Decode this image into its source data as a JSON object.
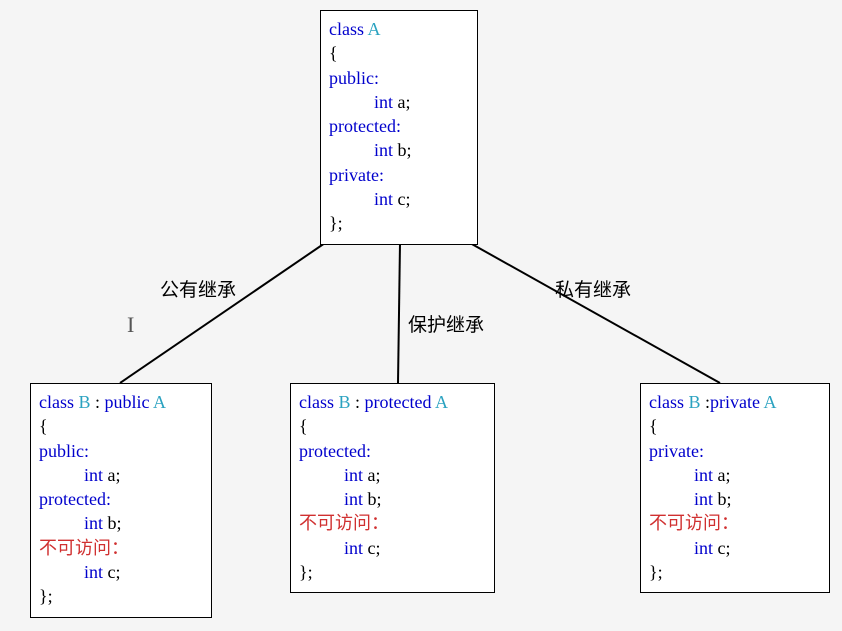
{
  "labels": {
    "public_inh": "公有继承",
    "protected_inh": "保护继承",
    "private_inh": "私有继承"
  },
  "boxA": {
    "decl_kw": "class",
    "decl_name": "A",
    "open": "{",
    "sec_public": "public:",
    "a": "a;",
    "sec_protected": "protected:",
    "b": "b;",
    "sec_private": "private:",
    "c": "c;",
    "close": "};",
    "int_kw": "int"
  },
  "boxPub": {
    "decl_kw": "class",
    "decl_name": "B",
    "colon": ":",
    "inh_kw": "public",
    "base": "A",
    "open": "{",
    "sec_public": "public:",
    "a": "a;",
    "sec_protected": "protected:",
    "b": "b;",
    "noaccess": "不可访问：",
    "c": "c;",
    "close": "};",
    "int_kw": "int"
  },
  "boxProt": {
    "decl_kw": "class",
    "decl_name": "B",
    "colon": ":",
    "inh_kw": "protected",
    "base": "A",
    "open": "{",
    "sec_protected": "protected:",
    "a": "a;",
    "b": "b;",
    "noaccess": "不可访问：",
    "c": "c;",
    "close": "};",
    "int_kw": "int"
  },
  "boxPriv": {
    "decl_kw": "class",
    "decl_name": "B",
    "colon": ":",
    "inh_kw": "private",
    "base": "A",
    "open": "{",
    "sec_private": "private:",
    "a": "a;",
    "b": "b;",
    "noaccess": "不可访问：",
    "c": "c;",
    "close": "};",
    "int_kw": "int"
  }
}
